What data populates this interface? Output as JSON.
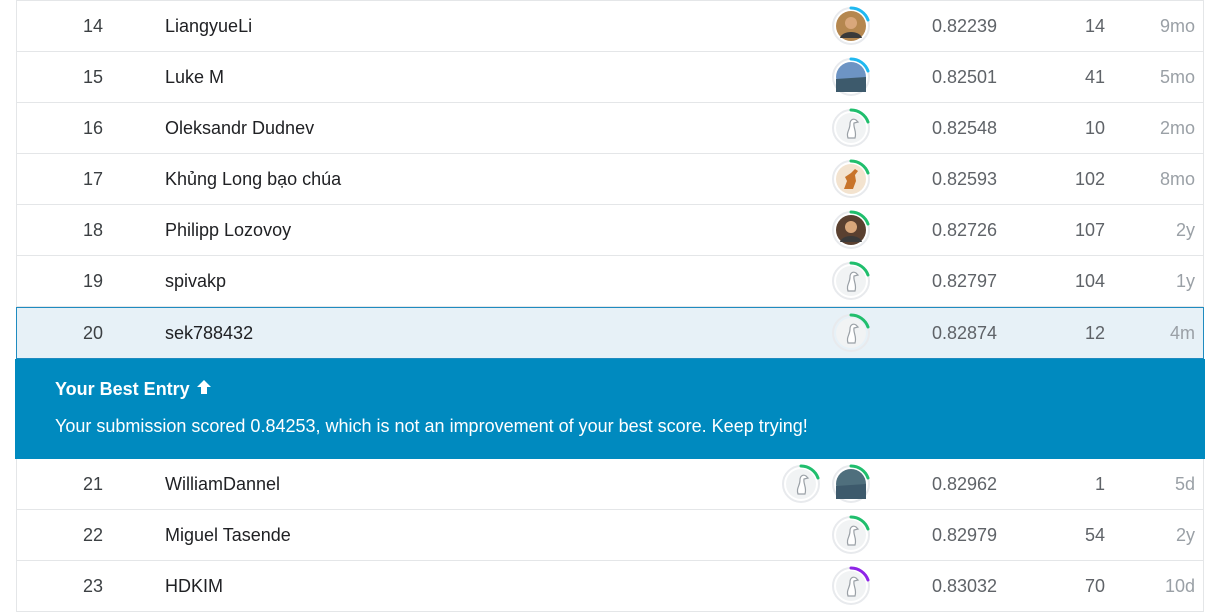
{
  "leaderboard": {
    "rows_above": [
      {
        "rank": "14",
        "name": "LiangyueLi",
        "score": "0.82239",
        "entries": "14",
        "last": "9mo",
        "avatars": [
          {
            "icon": "avatar-photo-person-icon",
            "ring": "#20b8f0",
            "fill": "#b5874f"
          }
        ]
      },
      {
        "rank": "15",
        "name": "Luke M",
        "score": "0.82501",
        "entries": "41",
        "last": "5mo",
        "avatars": [
          {
            "icon": "avatar-photo-landscape-icon",
            "ring": "#20b8f0",
            "fill": "#6d94c4"
          }
        ]
      },
      {
        "rank": "16",
        "name": "Oleksandr Dudnev",
        "score": "0.82548",
        "entries": "10",
        "last": "2mo",
        "avatars": [
          {
            "icon": "default-goose-avatar-icon",
            "ring": "#20be6d",
            "fill": "#e8eaed"
          }
        ]
      },
      {
        "rank": "17",
        "name": "Khủng Long bạo chúa",
        "score": "0.82593",
        "entries": "102",
        "last": "8mo",
        "avatars": [
          {
            "icon": "avatar-dinosaur-icon",
            "ring": "#20be6d",
            "fill": "#f3e3cf"
          }
        ]
      },
      {
        "rank": "18",
        "name": "Philipp Lozovoy",
        "score": "0.82726",
        "entries": "107",
        "last": "2y",
        "avatars": [
          {
            "icon": "avatar-photo-person-icon",
            "ring": "#20be6d",
            "fill": "#5a4030"
          }
        ]
      },
      {
        "rank": "19",
        "name": "spivakp",
        "score": "0.82797",
        "entries": "104",
        "last": "1y",
        "avatars": [
          {
            "icon": "default-goose-avatar-icon",
            "ring": "#20be6d",
            "fill": "#e8eaed"
          }
        ]
      }
    ],
    "current_row": {
      "rank": "20",
      "name": "sek788432",
      "score": "0.82874",
      "entries": "12",
      "last": "4m",
      "avatars": [
        {
          "icon": "default-goose-avatar-icon",
          "ring": "#20be6d",
          "fill": "#e8eaed"
        }
      ]
    },
    "banner": {
      "title": "Your Best Entry",
      "arrow_icon": "arrow-up-icon",
      "message": "Your submission scored 0.84253, which is not an improvement of your best score. Keep trying!"
    },
    "rows_below": [
      {
        "rank": "21",
        "name": "WilliamDannel",
        "score": "0.82962",
        "entries": "1",
        "last": "5d",
        "avatars": [
          {
            "icon": "default-goose-avatar-icon",
            "ring": "#20be6d",
            "fill": "#e8eaed"
          },
          {
            "icon": "avatar-photo-landscape-icon",
            "ring": "#20be6d",
            "fill": "#4f6f7d"
          }
        ]
      },
      {
        "rank": "22",
        "name": "Miguel Tasende",
        "score": "0.82979",
        "entries": "54",
        "last": "2y",
        "avatars": [
          {
            "icon": "default-goose-avatar-icon",
            "ring": "#20be6d",
            "fill": "#e8eaed"
          }
        ]
      },
      {
        "rank": "23",
        "name": "HDKIM",
        "score": "0.83032",
        "entries": "70",
        "last": "10d",
        "avatars": [
          {
            "icon": "default-goose-avatar-icon",
            "ring": "#8e24e6",
            "fill": "#e8eaed"
          }
        ]
      }
    ]
  },
  "colors": {
    "banner_bg": "#008abf",
    "highlight_bg": "#e7f1f7",
    "highlight_border": "#1f8bc0"
  }
}
